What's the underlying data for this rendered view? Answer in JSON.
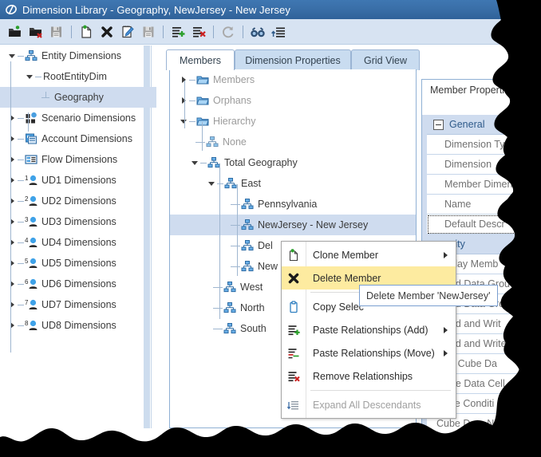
{
  "window": {
    "title": "Dimension Library - Geography, NewJersey - New Jersey",
    "app_icon": "oracle-o-icon"
  },
  "toolbar": {
    "buttons": [
      {
        "name": "new-folder-icon",
        "label": "New Folder"
      },
      {
        "name": "delete-folder-icon",
        "label": "Delete Folder"
      },
      {
        "name": "save-all-icon",
        "label": "Save All"
      },
      {
        "name": "new-document-icon",
        "label": "New"
      },
      {
        "name": "delete-icon",
        "label": "Delete"
      },
      {
        "name": "edit-icon",
        "label": "Edit"
      },
      {
        "name": "save-icon",
        "label": "Save"
      },
      {
        "name": "add-member-icon",
        "label": "Add Member"
      },
      {
        "name": "remove-member-icon",
        "label": "Remove Member"
      },
      {
        "name": "refresh-icon",
        "label": "Refresh"
      },
      {
        "name": "find-icon",
        "label": "Find"
      },
      {
        "name": "sort-icon",
        "label": "Sort"
      }
    ]
  },
  "sidebar": {
    "items": [
      {
        "label": "Entity Dimensions",
        "icon": "hierarchy-icon",
        "expanded": true,
        "level": 0,
        "selected": false
      },
      {
        "label": "RootEntityDim",
        "icon": "none",
        "expanded": true,
        "level": 1,
        "selected": false
      },
      {
        "label": "Geography",
        "icon": "none",
        "expanded": null,
        "level": 2,
        "selected": true
      },
      {
        "label": "Scenario Dimensions",
        "icon": "scenario-icon",
        "expanded": false,
        "level": 0,
        "selected": false
      },
      {
        "label": "Account Dimensions",
        "icon": "account-icon",
        "expanded": false,
        "level": 0,
        "selected": false
      },
      {
        "label": "Flow Dimensions",
        "icon": "flow-icon",
        "expanded": false,
        "level": 0,
        "selected": false
      },
      {
        "label": "UD1 Dimensions",
        "icon": "ud-icon",
        "badge": "1",
        "expanded": false,
        "level": 0,
        "selected": false
      },
      {
        "label": "UD2 Dimensions",
        "icon": "ud-icon",
        "badge": "2",
        "expanded": false,
        "level": 0,
        "selected": false
      },
      {
        "label": "UD3 Dimensions",
        "icon": "ud-icon",
        "badge": "3",
        "expanded": false,
        "level": 0,
        "selected": false
      },
      {
        "label": "UD4 Dimensions",
        "icon": "ud-icon",
        "badge": "4",
        "expanded": false,
        "level": 0,
        "selected": false
      },
      {
        "label": "UD5 Dimensions",
        "icon": "ud-icon",
        "badge": "5",
        "expanded": false,
        "level": 0,
        "selected": false
      },
      {
        "label": "UD6 Dimensions",
        "icon": "ud-icon",
        "badge": "6",
        "expanded": false,
        "level": 0,
        "selected": false
      },
      {
        "label": "UD7 Dimensions",
        "icon": "ud-icon",
        "badge": "7",
        "expanded": false,
        "level": 0,
        "selected": false
      },
      {
        "label": "UD8 Dimensions",
        "icon": "ud-icon",
        "badge": "8",
        "expanded": false,
        "level": 0,
        "selected": false
      }
    ]
  },
  "tabs": [
    {
      "label": "Members",
      "active": true
    },
    {
      "label": "Dimension Properties",
      "active": false
    },
    {
      "label": "Grid View",
      "active": false
    }
  ],
  "members_tree": [
    {
      "label": "Members",
      "icon": "folder-icon",
      "expanded": false,
      "level": 0,
      "dim": true,
      "selected": false
    },
    {
      "label": "Orphans",
      "icon": "folder-icon",
      "expanded": false,
      "level": 0,
      "dim": true,
      "selected": false
    },
    {
      "label": "Hierarchy",
      "icon": "folder-icon",
      "expanded": true,
      "level": 0,
      "dim": true,
      "selected": false
    },
    {
      "label": "None",
      "icon": "hierarchy-icon",
      "expanded": null,
      "level": 1,
      "dim": true,
      "selected": false
    },
    {
      "label": "Total Geography",
      "icon": "hierarchy-icon",
      "expanded": true,
      "level": 1,
      "dim": false,
      "selected": false
    },
    {
      "label": "East",
      "icon": "hierarchy-icon",
      "expanded": true,
      "level": 2,
      "dim": false,
      "selected": false
    },
    {
      "label": "Pennsylvania",
      "icon": "hierarchy-icon",
      "expanded": null,
      "level": 3,
      "dim": false,
      "selected": false
    },
    {
      "label": "NewJersey - New Jersey",
      "icon": "hierarchy-icon",
      "expanded": null,
      "level": 3,
      "dim": false,
      "selected": true
    },
    {
      "label": "Del",
      "icon": "hierarchy-icon",
      "expanded": null,
      "level": 3,
      "dim": false,
      "selected": false
    },
    {
      "label": "New",
      "icon": "hierarchy-icon",
      "expanded": null,
      "level": 3,
      "dim": false,
      "selected": false
    },
    {
      "label": "West",
      "icon": "hierarchy-icon",
      "expanded": null,
      "level": 2,
      "dim": false,
      "selected": false
    },
    {
      "label": "North",
      "icon": "hierarchy-icon",
      "expanded": null,
      "level": 2,
      "dim": false,
      "selected": false
    },
    {
      "label": "South",
      "icon": "hierarchy-icon",
      "expanded": null,
      "level": 2,
      "dim": false,
      "selected": false
    }
  ],
  "properties_panel": {
    "title": "Member Properties",
    "rows": [
      {
        "label": "General",
        "type": "category",
        "expanded": true
      },
      {
        "label": "Dimension Typ",
        "type": "prop"
      },
      {
        "label": "Dimension",
        "type": "prop"
      },
      {
        "label": "Member Dimen",
        "type": "prop"
      },
      {
        "label": "Name",
        "type": "prop"
      },
      {
        "label": "Default Descr",
        "type": "prop",
        "focused": true
      },
      {
        "label": "curity",
        "type": "category"
      },
      {
        "label": "splay Memb",
        "type": "prop"
      },
      {
        "label": "ead Data Grou",
        "type": "prop"
      },
      {
        "label": "ead Data Grou",
        "type": "prop"
      },
      {
        "label": "ead and Writ",
        "type": "prop"
      },
      {
        "label": "ead and Write",
        "type": "prop"
      },
      {
        "label": "se Cube Da",
        "type": "prop"
      },
      {
        "label": "ube Data Cell",
        "type": "prop"
      },
      {
        "label": "Cube Conditi",
        "type": "prop"
      },
      {
        "label": "Cube Data N",
        "type": "prop"
      }
    ]
  },
  "context_menu": {
    "items": [
      {
        "label": "Clone Member",
        "icon": "clone-member-icon",
        "submenu": true,
        "highlighted": false,
        "disabled": false
      },
      {
        "label": "Delete Member",
        "icon": "delete-member-icon",
        "submenu": false,
        "highlighted": true,
        "disabled": false
      },
      {
        "separator_after": true,
        "label": "",
        "icon": "none"
      },
      {
        "label": "Copy Selec",
        "icon": "copy-icon",
        "submenu": false,
        "highlighted": false,
        "disabled": false
      },
      {
        "label": "Paste Relationships (Add)",
        "icon": "paste-add-icon",
        "submenu": true,
        "highlighted": false,
        "disabled": false
      },
      {
        "label": "Paste Relationships (Move)",
        "icon": "paste-move-icon",
        "submenu": true,
        "highlighted": false,
        "disabled": false
      },
      {
        "label": "Remove Relationships",
        "icon": "remove-relationships-icon",
        "submenu": false,
        "highlighted": false,
        "disabled": false
      },
      {
        "separator_after": true,
        "label": "",
        "icon": "none"
      },
      {
        "label": "Expand All Descendants",
        "icon": "expand-all-icon",
        "submenu": false,
        "highlighted": false,
        "disabled": true
      }
    ]
  },
  "tooltip": {
    "text": "Delete Member 'NewJersey'"
  },
  "colors": {
    "titlebar": "#3a6fa8",
    "toolbar": "#d7e3f2",
    "selection": "#cfdcef",
    "menu_highlight": "#fdeba0",
    "accent_blue": "#4a90d9",
    "tab_inactive": "#c9dcf0"
  }
}
